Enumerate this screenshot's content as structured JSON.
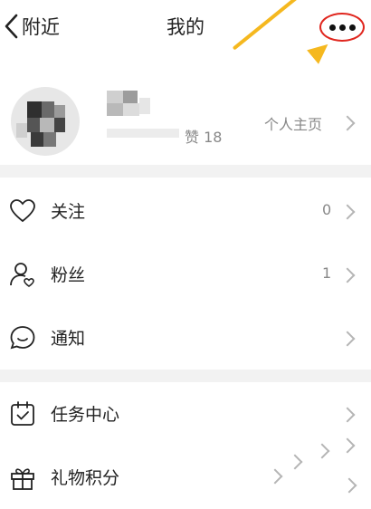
{
  "nav": {
    "back_label": "附近",
    "title": "我的",
    "more_icon": "more-dots-icon"
  },
  "profile": {
    "likes_text": "赞 18",
    "homepage_label": "个人主页"
  },
  "menu": {
    "items": [
      {
        "label": "关注",
        "count": "0",
        "icon": "heart-icon"
      },
      {
        "label": "粉丝",
        "count": "1",
        "icon": "fans-icon"
      },
      {
        "label": "通知",
        "count": "",
        "icon": "chat-bubble-icon"
      },
      {
        "label": "任务中心",
        "count": "",
        "icon": "task-checklist-icon"
      },
      {
        "label": "礼物积分",
        "count": "",
        "icon": "gift-icon"
      }
    ]
  },
  "colors": {
    "highlight_circle": "#e0261e",
    "annotation_arrow": "#f5b81f",
    "divider": "#f2f2f2"
  }
}
